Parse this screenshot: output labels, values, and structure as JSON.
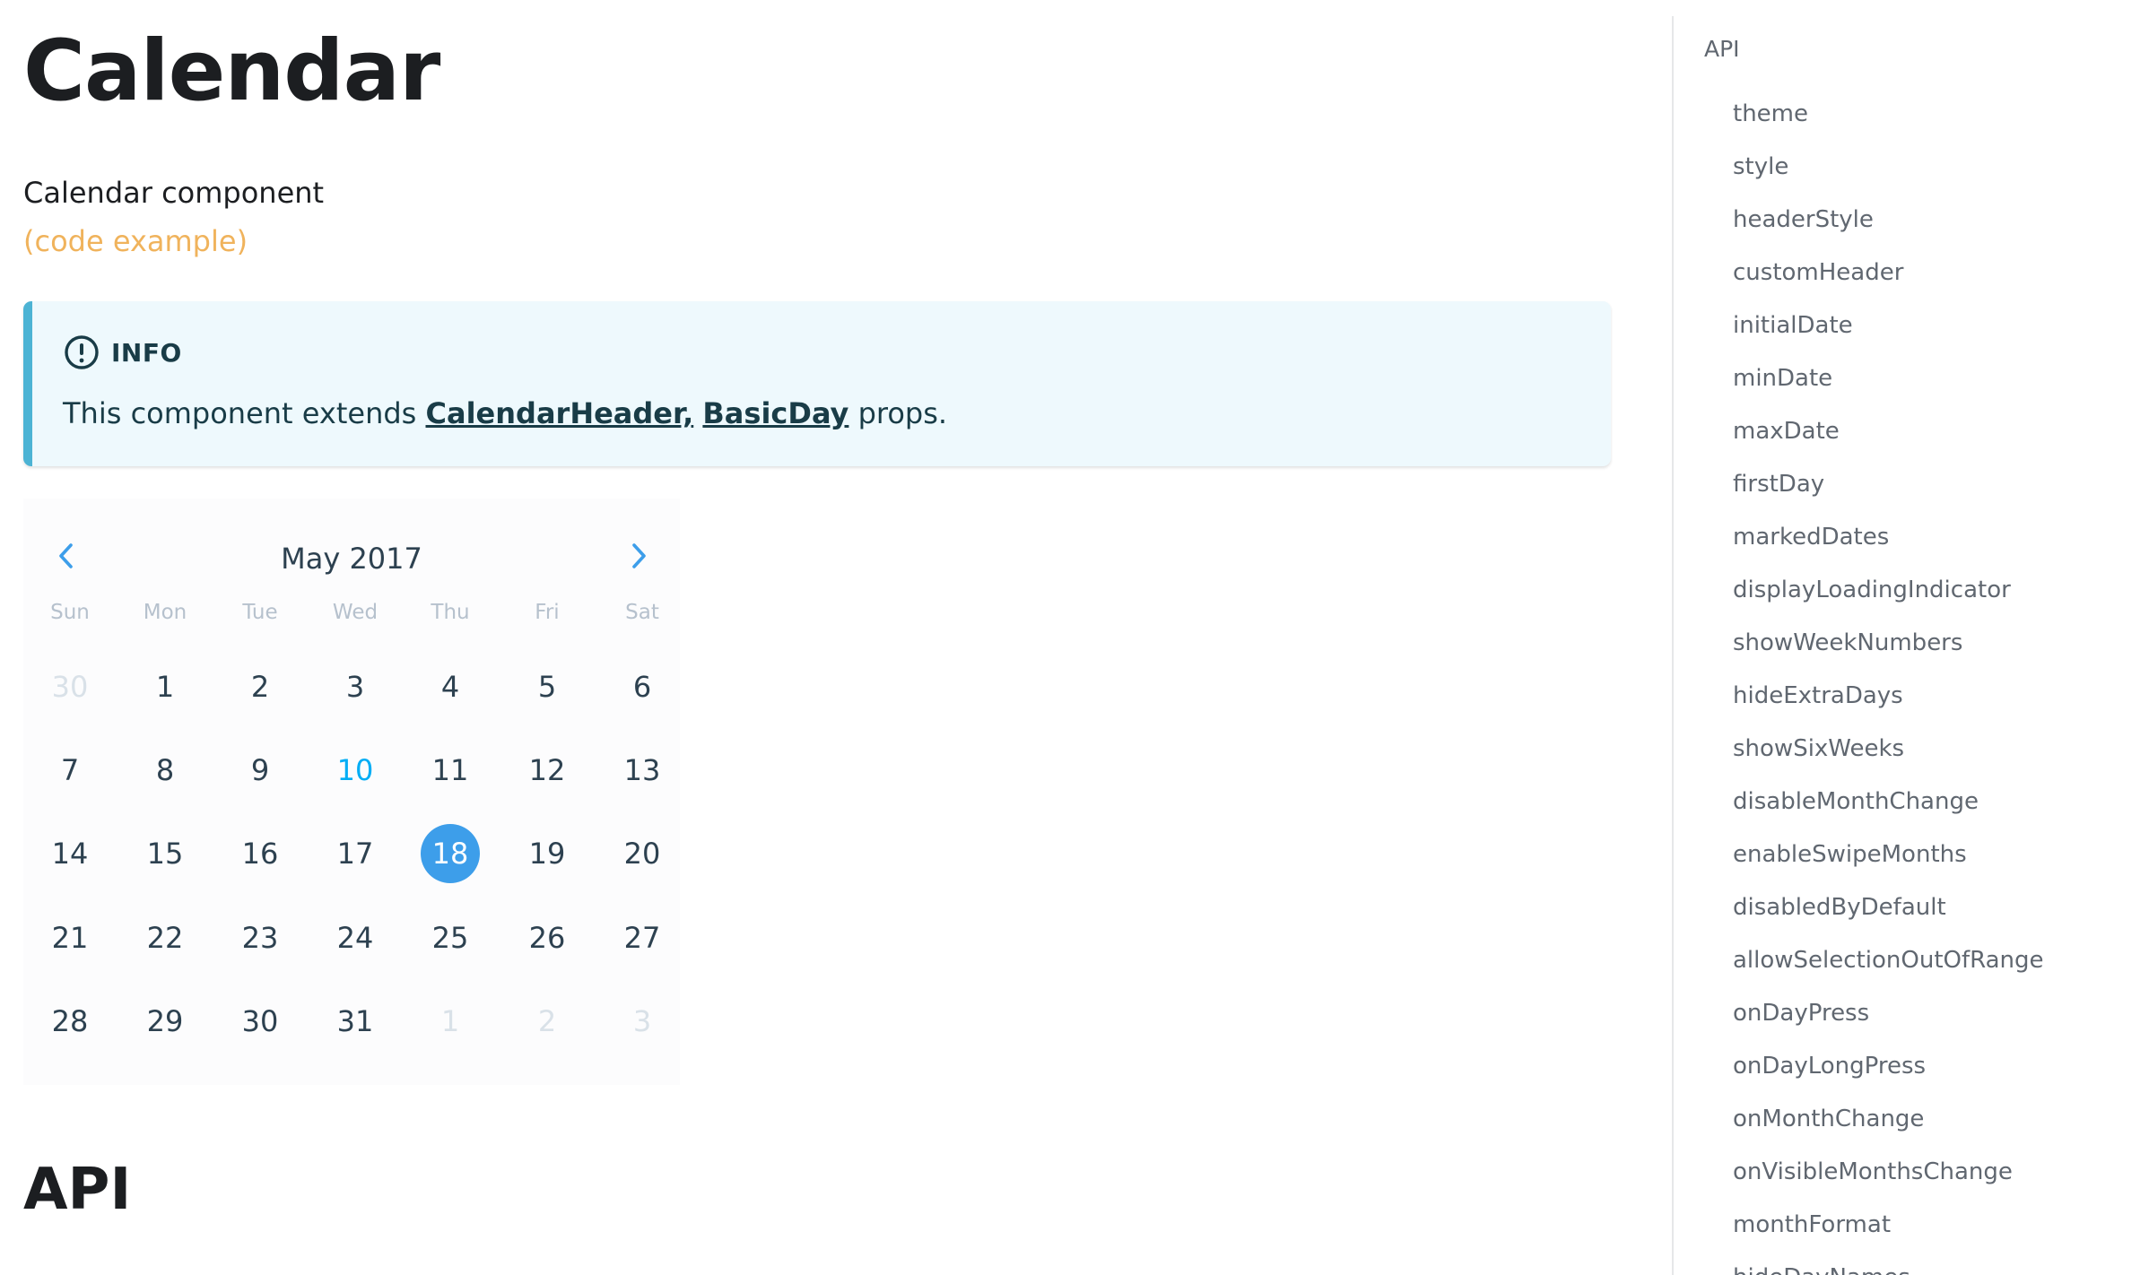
{
  "page": {
    "title": "Calendar",
    "intro": "Calendar component",
    "code_link": "(code example)",
    "api_heading": "API"
  },
  "info": {
    "icon": "info-circle-icon",
    "title": "INFO",
    "text_before": "This component extends ",
    "link1": "CalendarHeader,",
    "link2": "BasicDay",
    "text_after": " props."
  },
  "calendar": {
    "month_title": "May 2017",
    "prev_icon": "chevron-left-icon",
    "next_icon": "chevron-right-icon",
    "weekdays": [
      "Sun",
      "Mon",
      "Tue",
      "Wed",
      "Thu",
      "Fri",
      "Sat"
    ],
    "weeks": [
      [
        {
          "d": "30",
          "s": "other"
        },
        {
          "d": "1"
        },
        {
          "d": "2"
        },
        {
          "d": "3"
        },
        {
          "d": "4"
        },
        {
          "d": "5"
        },
        {
          "d": "6"
        }
      ],
      [
        {
          "d": "7"
        },
        {
          "d": "8"
        },
        {
          "d": "9"
        },
        {
          "d": "10",
          "s": "today"
        },
        {
          "d": "11"
        },
        {
          "d": "12"
        },
        {
          "d": "13"
        }
      ],
      [
        {
          "d": "14"
        },
        {
          "d": "15"
        },
        {
          "d": "16"
        },
        {
          "d": "17"
        },
        {
          "d": "18",
          "s": "selected"
        },
        {
          "d": "19"
        },
        {
          "d": "20"
        }
      ],
      [
        {
          "d": "21"
        },
        {
          "d": "22"
        },
        {
          "d": "23"
        },
        {
          "d": "24"
        },
        {
          "d": "25"
        },
        {
          "d": "26"
        },
        {
          "d": "27"
        }
      ],
      [
        {
          "d": "28"
        },
        {
          "d": "29"
        },
        {
          "d": "30"
        },
        {
          "d": "31"
        },
        {
          "d": "1",
          "s": "other"
        },
        {
          "d": "2",
          "s": "other"
        },
        {
          "d": "3",
          "s": "other"
        }
      ]
    ],
    "colors": {
      "selected": "#3d9eea",
      "today": "#00adf5",
      "arrow": "#3d9eea"
    }
  },
  "toc": {
    "top": "API",
    "items": [
      "theme",
      "style",
      "headerStyle",
      "customHeader",
      "initialDate",
      "minDate",
      "maxDate",
      "firstDay",
      "markedDates",
      "displayLoadingIndicator",
      "showWeekNumbers",
      "hideExtraDays",
      "showSixWeeks",
      "disableMonthChange",
      "enableSwipeMonths",
      "disabledByDefault",
      "allowSelectionOutOfRange",
      "onDayPress",
      "onDayLongPress",
      "onMonthChange",
      "onVisibleMonthsChange",
      "monthFormat",
      "hideDayNames"
    ]
  }
}
